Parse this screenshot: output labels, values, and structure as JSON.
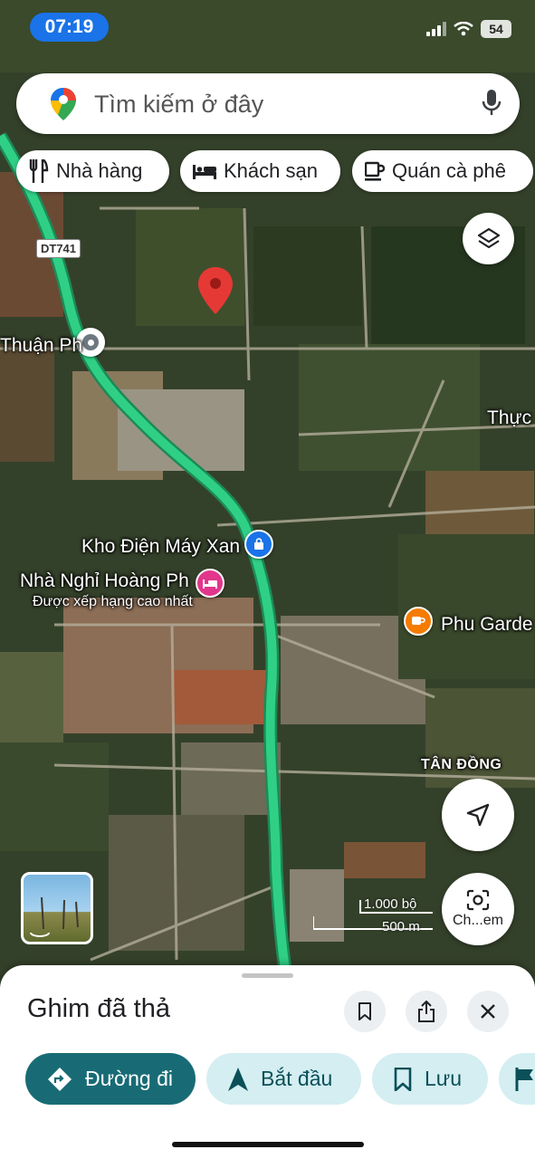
{
  "status": {
    "time": "07:19",
    "battery": "54"
  },
  "search": {
    "placeholder": "Tìm kiếm ở đây"
  },
  "chips": [
    {
      "label": "Nhà hàng",
      "icon": "fork-knife-icon"
    },
    {
      "label": "Khách sạn",
      "icon": "bed-icon"
    },
    {
      "label": "Quán cà phê",
      "icon": "coffee-cup-icon"
    }
  ],
  "map": {
    "road_badge": "DT741",
    "labels": {
      "thuan_phu": "Thuận Ph",
      "thuc": "Thực",
      "kho_dien_may": "Kho Điện Máy Xan",
      "nha_nghi": "Nhà Nghỉ Hoàng Ph",
      "nha_nghi_sub": "Được xếp hạng cao nhất",
      "phu_garden": "Phu Garde",
      "tan_dong": "TÂN ĐỒNG"
    },
    "scale": {
      "imperial": "1.000 bộ",
      "metric": "500 m"
    },
    "camera_label": "Ch...em"
  },
  "sheet": {
    "title": "Ghim đã thả",
    "actions": {
      "directions": "Đường đi",
      "start": "Bắt đầu",
      "save": "Lưu"
    }
  },
  "colors": {
    "route": "#2fd085",
    "pin": "#e53935",
    "primary_button": "#186b75",
    "secondary_button": "#d4eef2",
    "status_pill": "#1a73e8"
  }
}
